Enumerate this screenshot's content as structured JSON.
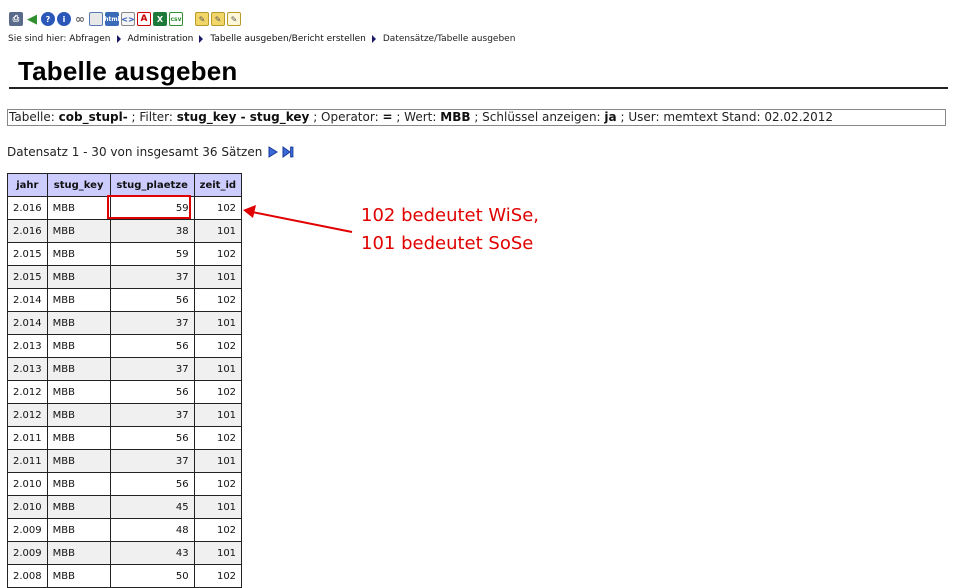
{
  "toolbar": {
    "icons": [
      "print-icon",
      "back-icon",
      "help-icon",
      "info-icon",
      "attach-icon",
      "table-icon",
      "html-icon",
      "xml-icon",
      "pdf-icon",
      "excel-icon",
      "csv-icon",
      "edit-icon",
      "folder-icon",
      "note-icon"
    ],
    "html_label": "html",
    "csv_label": "csv"
  },
  "breadcrumb": {
    "prefix": "Sie sind hier:",
    "items": [
      "Abfragen",
      "Administration",
      "Tabelle ausgeben/Bericht erstellen"
    ],
    "current": "Datensätze/Tabelle ausgeben"
  },
  "page": {
    "title": "Tabelle ausgeben"
  },
  "filter": {
    "tabelle_label": "Tabelle:",
    "tabelle_value": "cob_stupl-",
    "filter_label": "; Filter:",
    "filter_value": "stug_key - stug_key",
    "operator_label": "; Operator:",
    "operator_value": "=",
    "wert_label": "; Wert:",
    "wert_value": "MBB",
    "schluessel_label": "; Schlüssel anzeigen:",
    "schluessel_value": "ja",
    "user_text": "; User: memtext  Stand: 02.02.2012"
  },
  "records": {
    "info": "Datensatz 1 - 30 von insgesamt 36 Sätzen"
  },
  "table": {
    "headers": [
      "jahr",
      "stug_key",
      "stug_plaetze",
      "zeit_id"
    ],
    "rows": [
      [
        "2.016",
        "MBB",
        "59",
        "102"
      ],
      [
        "2.016",
        "MBB",
        "38",
        "101"
      ],
      [
        "2.015",
        "MBB",
        "59",
        "102"
      ],
      [
        "2.015",
        "MBB",
        "37",
        "101"
      ],
      [
        "2.014",
        "MBB",
        "56",
        "102"
      ],
      [
        "2.014",
        "MBB",
        "37",
        "101"
      ],
      [
        "2.013",
        "MBB",
        "56",
        "102"
      ],
      [
        "2.013",
        "MBB",
        "37",
        "101"
      ],
      [
        "2.012",
        "MBB",
        "56",
        "102"
      ],
      [
        "2.012",
        "MBB",
        "37",
        "101"
      ],
      [
        "2.011",
        "MBB",
        "56",
        "102"
      ],
      [
        "2.011",
        "MBB",
        "37",
        "101"
      ],
      [
        "2.010",
        "MBB",
        "56",
        "102"
      ],
      [
        "2.010",
        "MBB",
        "45",
        "101"
      ],
      [
        "2.009",
        "MBB",
        "48",
        "102"
      ],
      [
        "2.009",
        "MBB",
        "43",
        "101"
      ],
      [
        "2.008",
        "MBB",
        "50",
        "102"
      ]
    ]
  },
  "annotation": {
    "line1": "102 bedeutet WiSe,",
    "line2": "101 bedeutet SoSe",
    "color": "#e00000"
  }
}
